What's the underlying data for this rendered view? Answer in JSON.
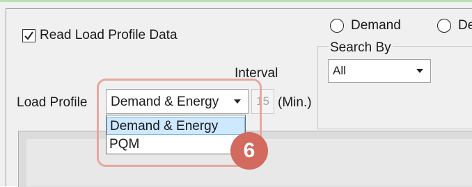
{
  "checkbox": {
    "label": "Read Load Profile Data",
    "checked": true
  },
  "radios": [
    {
      "label": "Demand",
      "selected": false
    },
    {
      "label": "De",
      "selected": false
    }
  ],
  "search_by": {
    "title": "Search By",
    "value": "All"
  },
  "interval": {
    "label": "Interval",
    "value": "15",
    "unit": "(Min.)"
  },
  "load_profile": {
    "label": "Load Profile",
    "selected": "Demand & Energy",
    "options": [
      "Demand & Energy",
      "PQM"
    ]
  },
  "annotation": {
    "step": "6",
    "color": "#d26a5f",
    "outline_color": "#e7a79f"
  },
  "icons": [
    "checkmark-icon",
    "radio-icon",
    "dropdown-arrow-icon"
  ]
}
